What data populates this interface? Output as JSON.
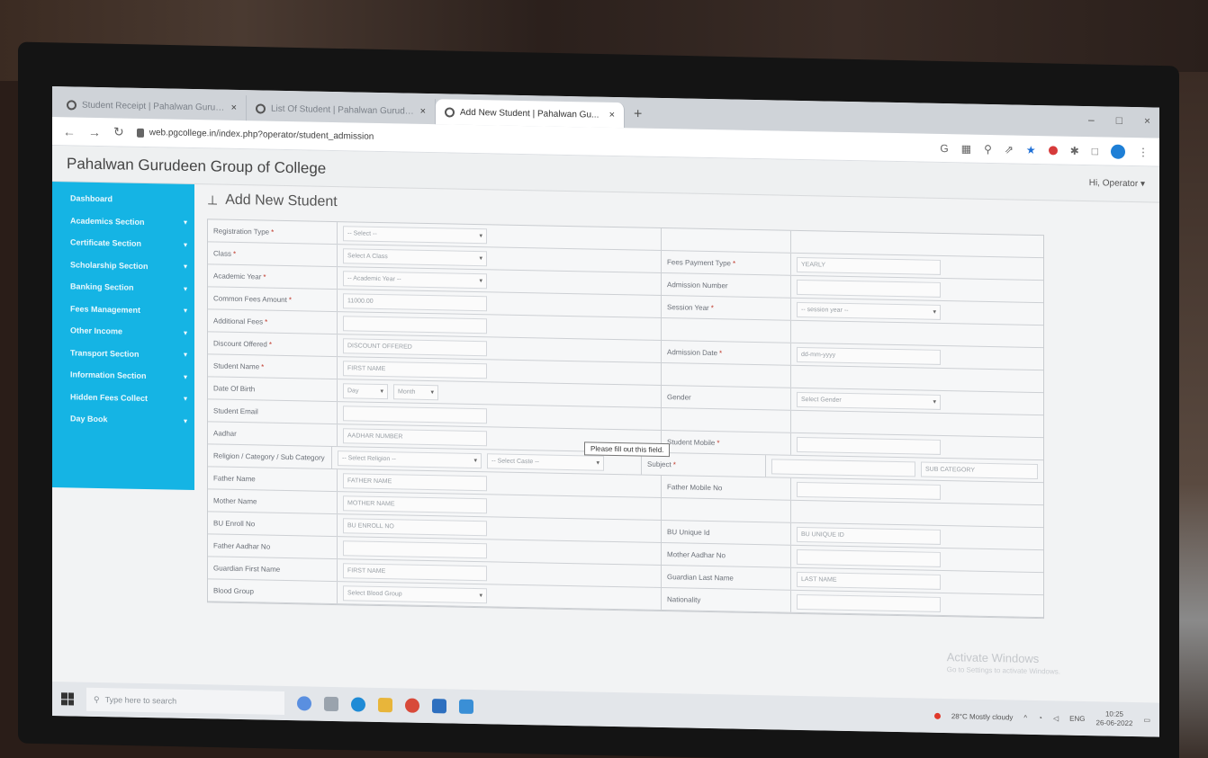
{
  "browser": {
    "tabs": [
      {
        "label": "Student Receipt | Pahalwan Gurudeen",
        "active": false
      },
      {
        "label": "List Of Student | Pahalwan Gurudeen",
        "active": false
      },
      {
        "label": "Add New Student | Pahalwan Gu...",
        "active": true
      }
    ],
    "new_tab": "+",
    "window_controls": [
      "–",
      "□",
      "×"
    ],
    "url": "web.pgcollege.in/index.php?operator/student_admission"
  },
  "app": {
    "title": "Pahalwan Gurudeen Group of College",
    "user_menu": "Hi, Operator ▾"
  },
  "sidebar": {
    "items": [
      {
        "label": "Dashboard",
        "caret": ""
      },
      {
        "label": "Academics Section",
        "caret": "▾"
      },
      {
        "label": "Certificate Section",
        "caret": "▾"
      },
      {
        "label": "Scholarship Section",
        "caret": "▾"
      },
      {
        "label": "Banking Section",
        "caret": "▾"
      },
      {
        "label": "Fees Management",
        "caret": "▾"
      },
      {
        "label": "Other Income",
        "caret": "▾"
      },
      {
        "label": "Transport Section",
        "caret": "▾"
      },
      {
        "label": "Information Section",
        "caret": "▾"
      },
      {
        "label": "Hidden Fees Collect",
        "caret": "▾"
      },
      {
        "label": "Day Book",
        "caret": "▾"
      }
    ]
  },
  "page": {
    "title": "Add New Student",
    "tooltip": "Please fill out this field.",
    "watermark": "Activate Windows",
    "watermark_sub": "Go to Settings to activate Windows."
  },
  "form": {
    "rows": [
      {
        "l1": "Registration Type",
        "r1": true,
        "v1": "-- Select --",
        "s1": true,
        "l2": "",
        "r2": false,
        "v2": "",
        "s2": false
      },
      {
        "l1": "Class",
        "r1": true,
        "v1": "Select A Class",
        "s1": true,
        "l2": "Fees Payment Type",
        "r2": true,
        "v2": "YEARLY",
        "s2": false
      },
      {
        "l1": "Academic Year",
        "r1": true,
        "v1": "-- Academic Year --",
        "s1": true,
        "l2": "Admission Number",
        "r2": false,
        "v2": "",
        "s2": false
      },
      {
        "l1": "Common Fees Amount",
        "r1": true,
        "v1": "11000.00",
        "s1": false,
        "l2": "Session Year",
        "r2": true,
        "v2": "-- session year --",
        "s2": true
      },
      {
        "l1": "Additional Fees",
        "r1": true,
        "v1": "",
        "s1": false,
        "l2": "",
        "r2": false,
        "v2": "",
        "s2": false
      },
      {
        "l1": "Discount Offered",
        "r1": true,
        "v1": "DISCOUNT OFFERED",
        "s1": false,
        "l2": "Admission Date",
        "r2": true,
        "v2": "dd-mm-yyyy",
        "s2": false
      },
      {
        "l1": "Student Name",
        "r1": true,
        "v1": "FIRST NAME",
        "s1": false,
        "l2": "",
        "r2": false,
        "v2": "",
        "s2": false
      },
      {
        "l1": "Date Of Birth",
        "r1": false,
        "v1": "Day",
        "s1": true,
        "l2": "Gender",
        "r2": false,
        "v2": "Select Gender",
        "s2": true
      },
      {
        "l1": "Student Email",
        "r1": false,
        "v1": "",
        "s1": false,
        "l2": "",
        "r2": false,
        "v2": "",
        "s2": false
      },
      {
        "l1": "Aadhar",
        "r1": false,
        "v1": "AADHAR NUMBER",
        "s1": false,
        "l2": "Student Mobile",
        "r2": true,
        "v2": "",
        "s2": false
      },
      {
        "l1": "Religion / Category / Sub Category",
        "r1": false,
        "v1": "-- Select Religion --",
        "s1": true,
        "l2": "Subject",
        "r2": true,
        "v2": "",
        "s2": false
      },
      {
        "l1": "Father Name",
        "r1": false,
        "v1": "FATHER NAME",
        "s1": false,
        "l2": "Father Mobile No",
        "r2": false,
        "v2": "",
        "s2": false
      },
      {
        "l1": "Mother Name",
        "r1": false,
        "v1": "MOTHER NAME",
        "s1": false,
        "l2": "",
        "r2": false,
        "v2": "",
        "s2": false
      },
      {
        "l1": "BU Enroll No",
        "r1": false,
        "v1": "BU ENROLL NO",
        "s1": false,
        "l2": "BU Unique Id",
        "r2": false,
        "v2": "BU UNIQUE ID",
        "s2": false
      },
      {
        "l1": "Father Aadhar No",
        "r1": false,
        "v1": "",
        "s1": false,
        "l2": "Mother Aadhar No",
        "r2": false,
        "v2": "",
        "s2": false
      },
      {
        "l1": "Guardian First Name",
        "r1": false,
        "v1": "FIRST NAME",
        "s1": false,
        "l2": "Guardian Last Name",
        "r2": false,
        "v2": "LAST NAME",
        "s2": false
      },
      {
        "l1": "Blood Group",
        "r1": false,
        "v1": "Select Blood Group",
        "s1": true,
        "l2": "Nationality",
        "r2": false,
        "v2": "",
        "s2": false
      }
    ],
    "dob_month": "Month",
    "caste": "-- Select Caste --",
    "subcategory": "SUB CATEGORY"
  },
  "taskbar": {
    "search_placeholder": "Type here to search",
    "weather": "28°C  Mostly cloudy",
    "lang": "ENG",
    "time": "10:25",
    "date": "26-06-2022"
  }
}
